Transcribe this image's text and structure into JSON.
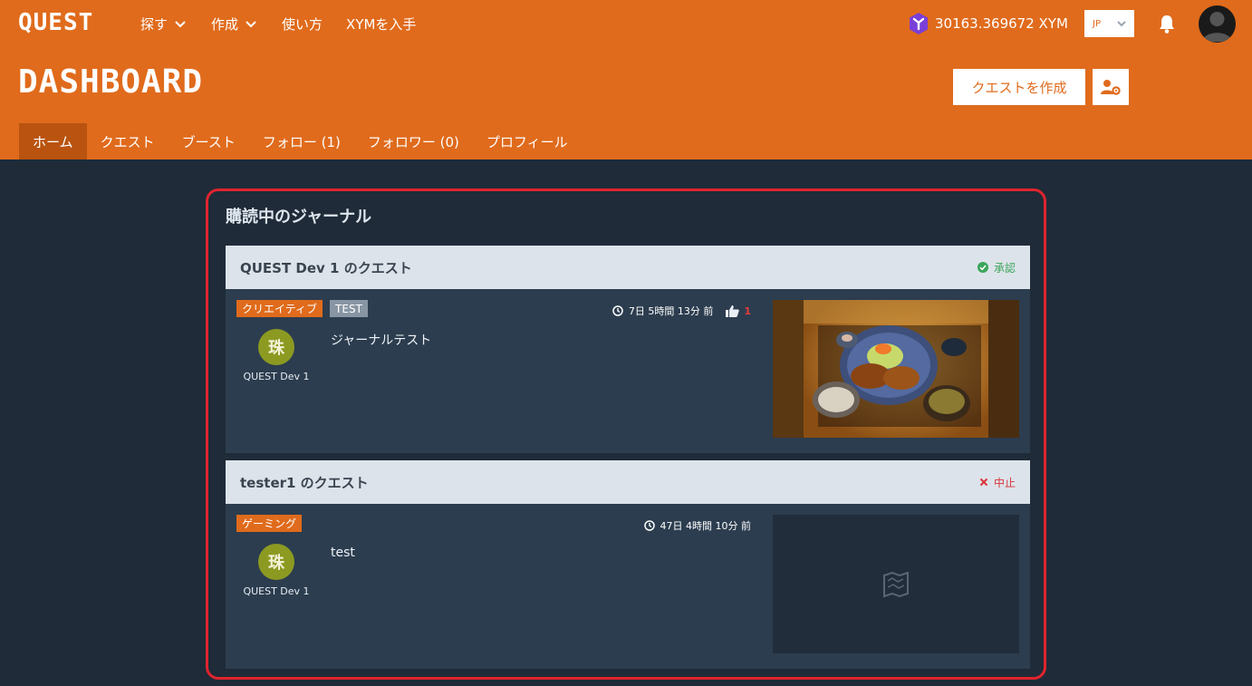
{
  "app": {
    "logo": "QUEST",
    "nav": [
      {
        "label": "探す"
      },
      {
        "label": "作成"
      },
      {
        "label": "使い方"
      },
      {
        "label": "XYMを入手"
      }
    ],
    "wallet_balance": "30163.369672 XYM",
    "language": "JP"
  },
  "page": {
    "title": "DASHBOARD",
    "create_button": "クエストを作成"
  },
  "tabs": [
    {
      "label": "ホーム"
    },
    {
      "label": "クエスト"
    },
    {
      "label": "ブースト"
    },
    {
      "label": "フォロー (1)"
    },
    {
      "label": "フォロワー (0)"
    },
    {
      "label": "プロフィール"
    }
  ],
  "section": {
    "title": "購読中のジャーナル"
  },
  "journals": [
    {
      "quest_title": "QUEST Dev 1 のクエスト",
      "status": "承認",
      "tags": [
        "クリエイティブ",
        "TEST"
      ],
      "author": "QUEST Dev 1",
      "text": "ジャーナルテスト",
      "time": "7日 5時間 13分 前",
      "likes": "1"
    },
    {
      "quest_title": "tester1 のクエスト",
      "status": "中止",
      "tags": [
        "ゲーミング"
      ],
      "author": "QUEST Dev 1",
      "text": "test",
      "time": "47日 4時間 10分 前"
    }
  ],
  "colors": {
    "header": "#e06b1c",
    "background": "#1f2b38",
    "card_body": "#2c3d4f",
    "approved": "#3aa55a",
    "cancelled": "#d9343a",
    "highlight_border": "#e0242e"
  }
}
